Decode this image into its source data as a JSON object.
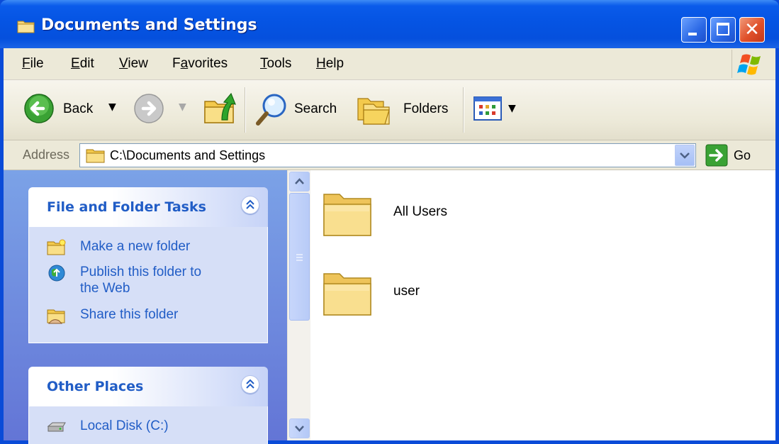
{
  "window": {
    "title": "Documents and Settings",
    "icon": "folder-icon",
    "colors": {
      "titlebar": "#0554e3",
      "menubar": "#ece9d8",
      "taskpane": "#6f8fe0",
      "task_link": "#215dc6"
    }
  },
  "title_buttons": {
    "minimize": "minimize-icon",
    "maximize": "maximize-icon",
    "close": "close-icon"
  },
  "menu": {
    "items": [
      {
        "label": "File",
        "accelerator": "F"
      },
      {
        "label": "Edit",
        "accelerator": "E"
      },
      {
        "label": "View",
        "accelerator": "V"
      },
      {
        "label": "Favorites",
        "accelerator": "a"
      },
      {
        "label": "Tools",
        "accelerator": "T"
      },
      {
        "label": "Help",
        "accelerator": "H"
      }
    ],
    "logo": "windows-logo-icon"
  },
  "toolbar": {
    "back_label": "Back",
    "search_label": "Search",
    "folders_label": "Folders",
    "icons": [
      "back-arrow-icon",
      "forward-arrow-icon",
      "up-folder-icon",
      "search-icon",
      "folders-icon",
      "views-icon"
    ]
  },
  "address": {
    "label": "Address",
    "value": "C:\\Documents and Settings",
    "go_label": "Go"
  },
  "task_panes": [
    {
      "title": "File and Folder Tasks",
      "tasks": [
        {
          "label": "Make a new folder",
          "icon": "new-folder-icon"
        },
        {
          "label": "Publish this folder to the Web",
          "line1": "Publish this folder to",
          "line2": "the Web",
          "icon": "publish-web-icon"
        },
        {
          "label": "Share this folder",
          "icon": "share-folder-icon"
        }
      ]
    },
    {
      "title": "Other Places",
      "tasks": [
        {
          "label": "Local Disk (C:)",
          "icon": "local-disk-icon"
        }
      ]
    }
  ],
  "files": [
    {
      "name": "All Users",
      "icon": "folder-icon"
    },
    {
      "name": "user",
      "icon": "folder-icon"
    }
  ]
}
